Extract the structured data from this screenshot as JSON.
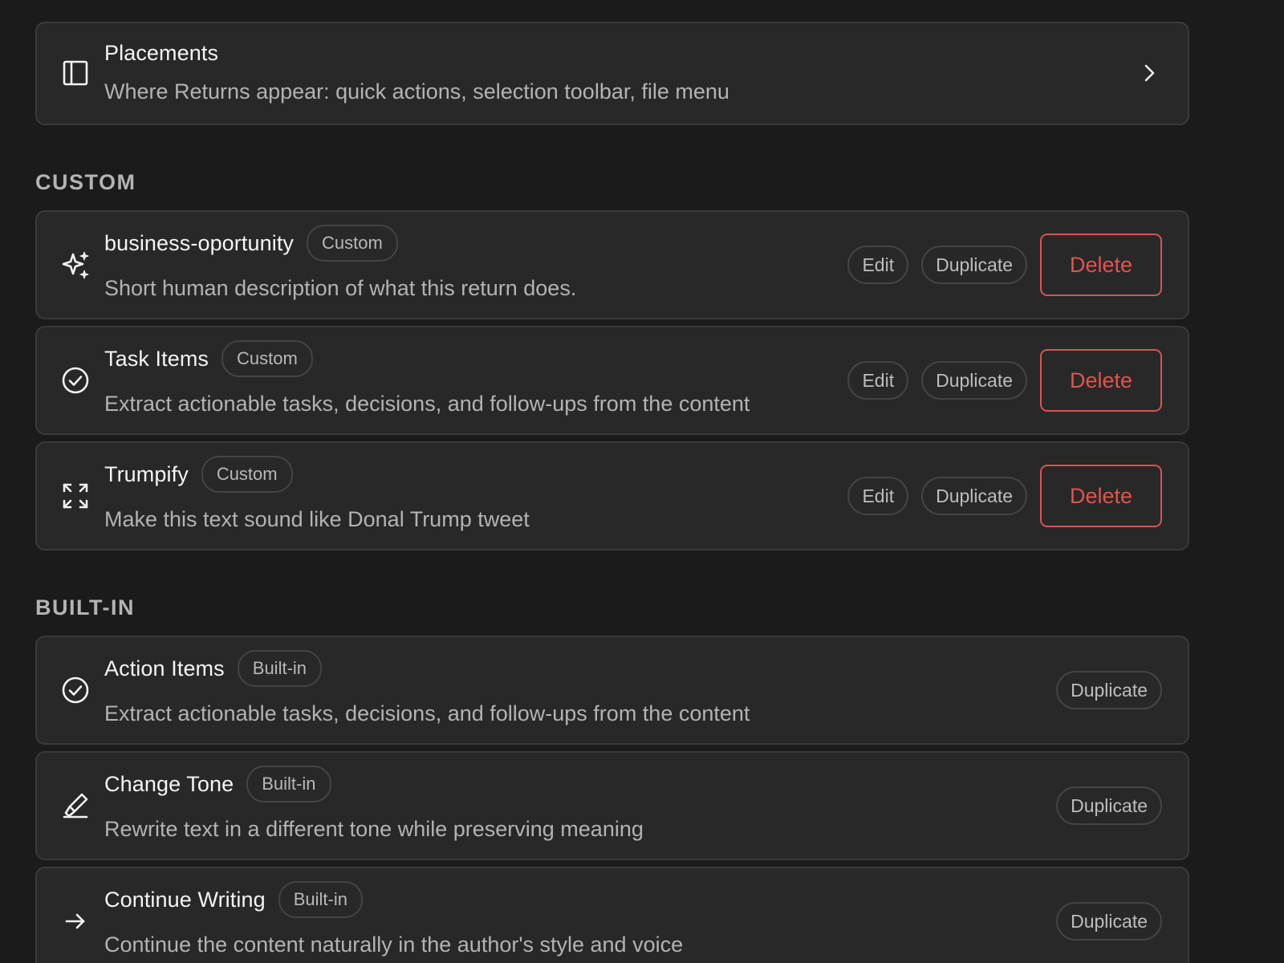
{
  "placements": {
    "title": "Placements",
    "description": "Where Returns appear: quick actions, selection toolbar, file menu",
    "icon": "sidebar-panel-icon"
  },
  "sections": {
    "custom_label": "CUSTOM",
    "builtin_label": "BUILT-IN"
  },
  "custom_items": [
    {
      "title": "business-oportunity",
      "badge": "Custom",
      "description": "Short human description of what this return does.",
      "icon": "sparkles-icon",
      "edit_label": "Edit",
      "duplicate_label": "Duplicate",
      "delete_label": "Delete"
    },
    {
      "title": "Task Items",
      "badge": "Custom",
      "description": "Extract actionable tasks, decisions, and follow-ups from the content",
      "icon": "check-circle-icon",
      "edit_label": "Edit",
      "duplicate_label": "Duplicate",
      "delete_label": "Delete"
    },
    {
      "title": "Trumpify",
      "badge": "Custom",
      "description": "Make this text sound like Donal Trump tweet",
      "icon": "expand-arrows-icon",
      "edit_label": "Edit",
      "duplicate_label": "Duplicate",
      "delete_label": "Delete"
    }
  ],
  "builtin_items": [
    {
      "title": "Action Items",
      "badge": "Built-in",
      "description": "Extract actionable tasks, decisions, and follow-ups from the content",
      "icon": "check-circle-icon",
      "duplicate_label": "Duplicate"
    },
    {
      "title": "Change Tone",
      "badge": "Built-in",
      "description": "Rewrite text in a different tone while preserving meaning",
      "icon": "highlighter-icon",
      "duplicate_label": "Duplicate"
    },
    {
      "title": "Continue Writing",
      "badge": "Built-in",
      "description": "Continue the content naturally in the author's style and voice",
      "icon": "arrow-right-icon",
      "duplicate_label": "Duplicate"
    }
  ],
  "colors": {
    "background": "#1b1b1b",
    "card": "#282828",
    "danger": "#e2534e"
  }
}
